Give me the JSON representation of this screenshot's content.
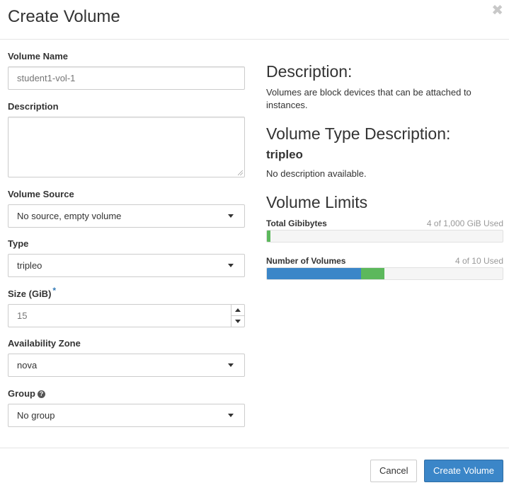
{
  "header": {
    "title": "Create Volume",
    "close_glyph": "✖"
  },
  "form": {
    "volume_name": {
      "label": "Volume Name",
      "placeholder": "student1-vol-1"
    },
    "description": {
      "label": "Description",
      "value": ""
    },
    "volume_source": {
      "label": "Volume Source",
      "selected": "No source, empty volume"
    },
    "type": {
      "label": "Type",
      "selected": "tripleo"
    },
    "size": {
      "label": "Size (GiB)",
      "required_mark": "*",
      "value": "15"
    },
    "availability_zone": {
      "label": "Availability Zone",
      "selected": "nova"
    },
    "group": {
      "label": "Group",
      "help_glyph": "?",
      "selected": "No group"
    }
  },
  "info": {
    "description_heading": "Description:",
    "description_text": "Volumes are block devices that can be attached to instances.",
    "type_heading": "Volume Type Description:",
    "type_name": "tripleo",
    "type_text": "No description available.",
    "limits_heading": "Volume Limits",
    "limits": [
      {
        "label": "Total Gibibytes",
        "used_text": "4 of 1,000 GiB Used",
        "segments": [
          {
            "fraction": 0.015,
            "color": "#5cb85c"
          }
        ]
      },
      {
        "label": "Number of Volumes",
        "used_text": "4 of 10 Used",
        "segments": [
          {
            "fraction": 0.4,
            "color": "#3b86c8"
          },
          {
            "fraction": 0.1,
            "color": "#5cb85c"
          }
        ]
      }
    ]
  },
  "footer": {
    "cancel_label": "Cancel",
    "submit_label": "Create Volume"
  },
  "colors": {
    "primary": "#3b86c8",
    "success": "#5cb85c",
    "required": "#337ab7"
  }
}
